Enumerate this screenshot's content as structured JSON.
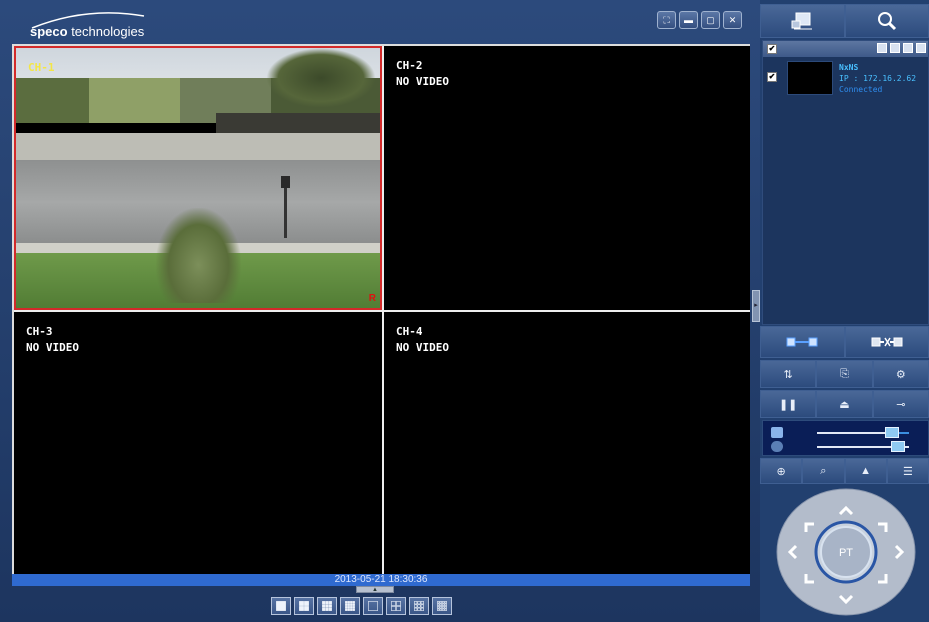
{
  "app": {
    "logo": {
      "bold": "speco",
      "rest": " technologies"
    }
  },
  "window_buttons": [
    {
      "name": "fullscreen-button",
      "icon": "fullscreen-icon",
      "glyph": "⛶"
    },
    {
      "name": "minimize-button",
      "icon": "minimize-icon",
      "glyph": "▬"
    },
    {
      "name": "maximize-button",
      "icon": "maximize-icon",
      "glyph": "▢"
    },
    {
      "name": "close-button",
      "icon": "close-icon",
      "glyph": "✕"
    }
  ],
  "channels": [
    {
      "label": "CH-1",
      "status": "",
      "label_color": "#f3e646"
    },
    {
      "label": "CH-2",
      "status": "NO VIDEO"
    },
    {
      "label": "CH-3",
      "status": "NO VIDEO"
    },
    {
      "label": "CH-4",
      "status": "NO VIDEO"
    }
  ],
  "rec_indicator": "R",
  "timestamp": "2013-05-21 18:30:36",
  "layout_buttons": [
    "1x1",
    "2x2",
    "3x3",
    "4x4",
    "single",
    "2x2-alt",
    "3x3-alt",
    "4x4-alt"
  ],
  "panel": {
    "top_tabs": [
      {
        "name": "device-list-tab",
        "icon": "device-list-icon"
      },
      {
        "name": "search-tab",
        "icon": "search-icon"
      }
    ],
    "device": {
      "name": "NxNS",
      "ip": "IP : 172.16.2.62",
      "status": "Connected",
      "checked": true
    },
    "connect_buttons": [
      {
        "name": "connect-button",
        "icon": "connect-icon"
      },
      {
        "name": "disconnect-button",
        "icon": "disconnect-icon"
      }
    ],
    "control_rows": [
      [
        "sort-icon",
        "export-icon",
        "camera-settings-icon"
      ],
      [
        "pause-icon",
        "alarm-icon",
        "record-icon"
      ]
    ],
    "volume": {
      "speaker_level": 0.82,
      "mic_level": 0.88
    },
    "view_buttons": [
      "zoom-in-icon",
      "zoom-search-icon",
      "picture-icon",
      "snapshot-list-icon"
    ],
    "ptz_label": "PT"
  },
  "colors": {
    "accent": "#2f6ad0",
    "device_name": "#49c0ff",
    "device_status": "#2f8ef0",
    "rec": "#e01010",
    "selected_border": "#d32a2a"
  }
}
